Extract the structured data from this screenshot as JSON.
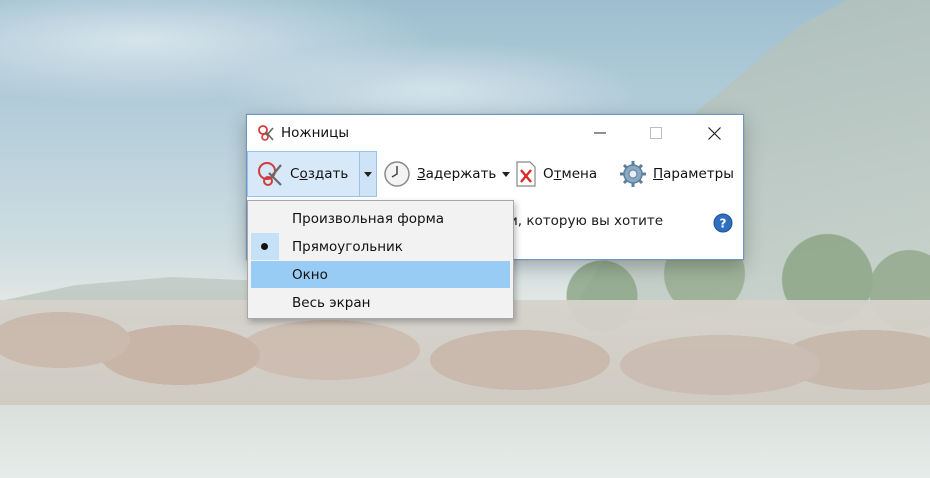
{
  "window": {
    "title": "Ножницы",
    "controls": {
      "minimize": "—",
      "maximize": "☐",
      "close": "✕"
    }
  },
  "toolbar": {
    "create": {
      "prefix": "С",
      "underlined": "о",
      "rest": "здать"
    },
    "delay": {
      "underlined": "З",
      "rest": "адержать"
    },
    "cancel": {
      "prefix": "О",
      "underlined": "т",
      "rest": "мена"
    },
    "options": {
      "underlined": "П",
      "rest": "араметры"
    }
  },
  "info": {
    "text": "и, которую вы хотите"
  },
  "menu": {
    "items": [
      {
        "label": "Произвольная форма",
        "checked": false,
        "highlighted": false
      },
      {
        "label": "Прямоугольник",
        "checked": true,
        "highlighted": false
      },
      {
        "label": "Окно",
        "checked": false,
        "highlighted": true
      },
      {
        "label": "Весь экран",
        "checked": false,
        "highlighted": false
      }
    ]
  },
  "colors": {
    "window_border": "#6f95c4",
    "create_button_bg": "#d7e8f8",
    "menu_highlight": "#99ccf4",
    "menu_check_strip": "#c5e1f7",
    "help_icon": "#2f6fc0"
  },
  "icons": [
    "scissors-icon",
    "clock-icon",
    "cancel-document-icon",
    "gear-icon",
    "help-icon",
    "dropdown-arrow-icon"
  ]
}
